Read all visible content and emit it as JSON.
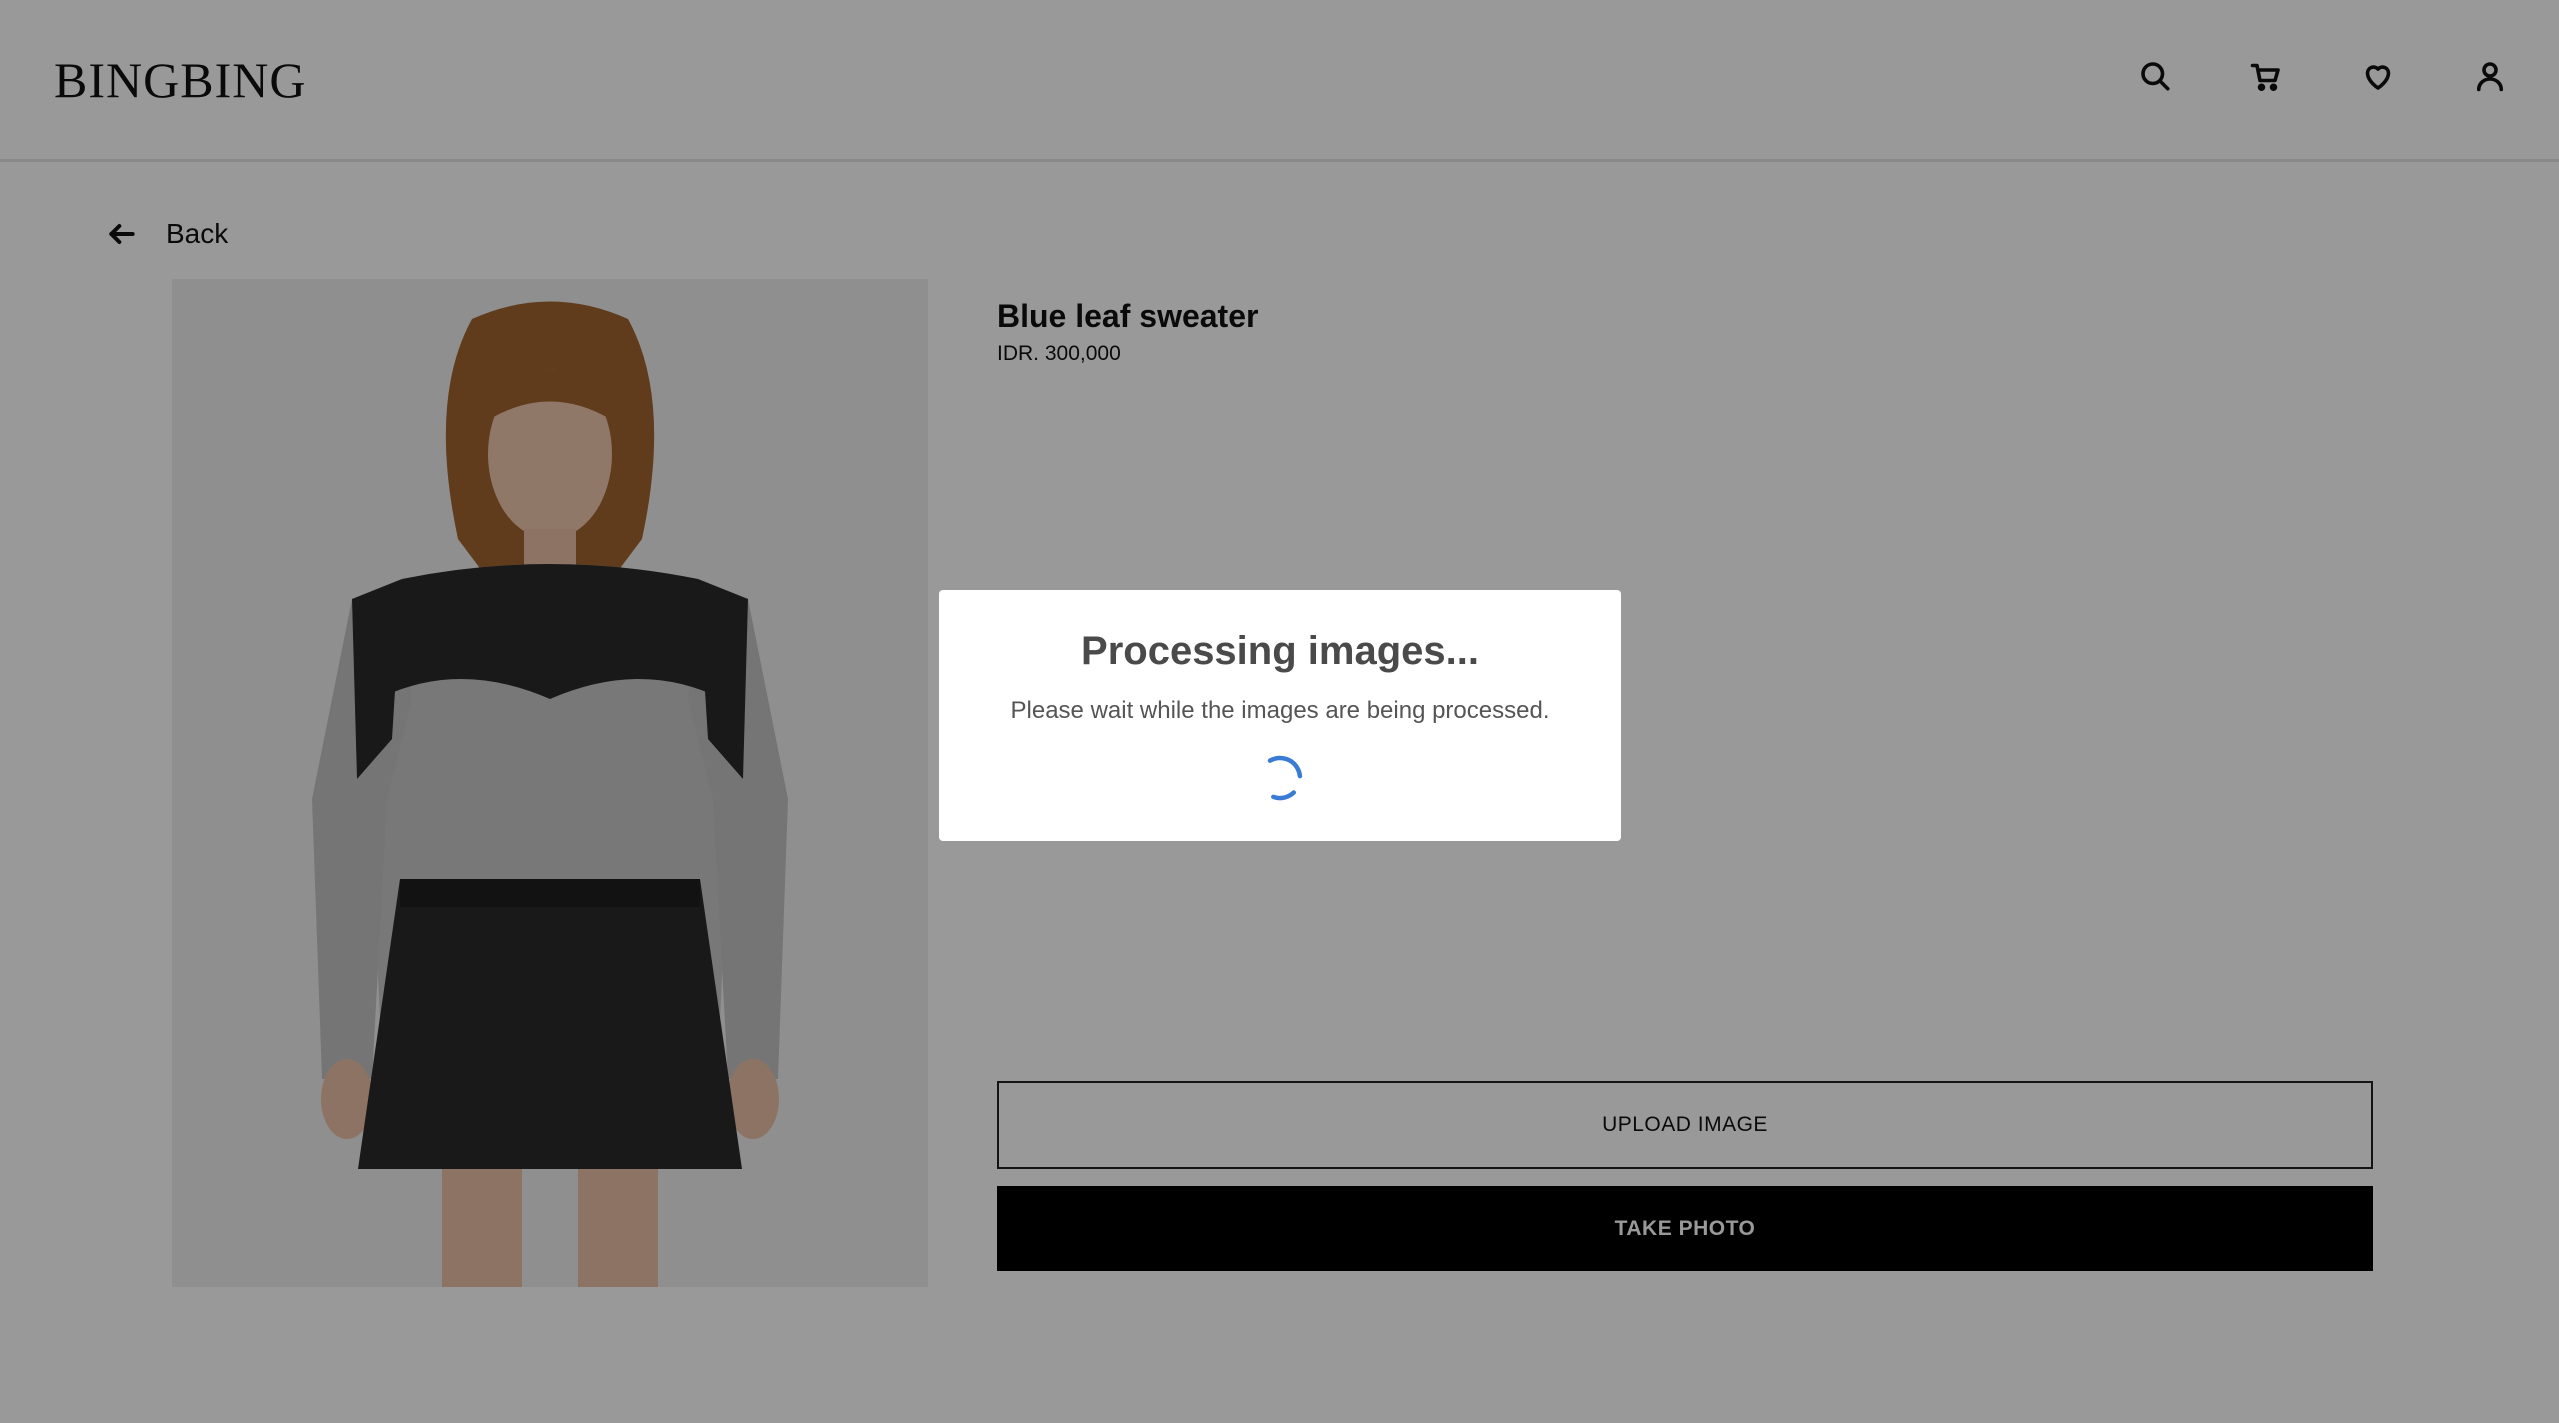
{
  "header": {
    "logo": "BINGBING",
    "icons": [
      "search-icon",
      "cart-icon",
      "heart-icon",
      "user-icon"
    ]
  },
  "back": {
    "label": "Back",
    "icon": "arrow-left-icon"
  },
  "product": {
    "title": "Blue leaf sweater",
    "price": "IDR. 300,000"
  },
  "buttons": {
    "upload_label": "UPLOAD IMAGE",
    "take_photo_label": "TAKE PHOTO"
  },
  "modal": {
    "title": "Processing images...",
    "message": "Please wait while the images are being processed.",
    "spinner_color": "#3a7bd5"
  },
  "colors": {
    "overlay": "rgba(0,0,0,0.40)",
    "primary_button": "#000000"
  }
}
